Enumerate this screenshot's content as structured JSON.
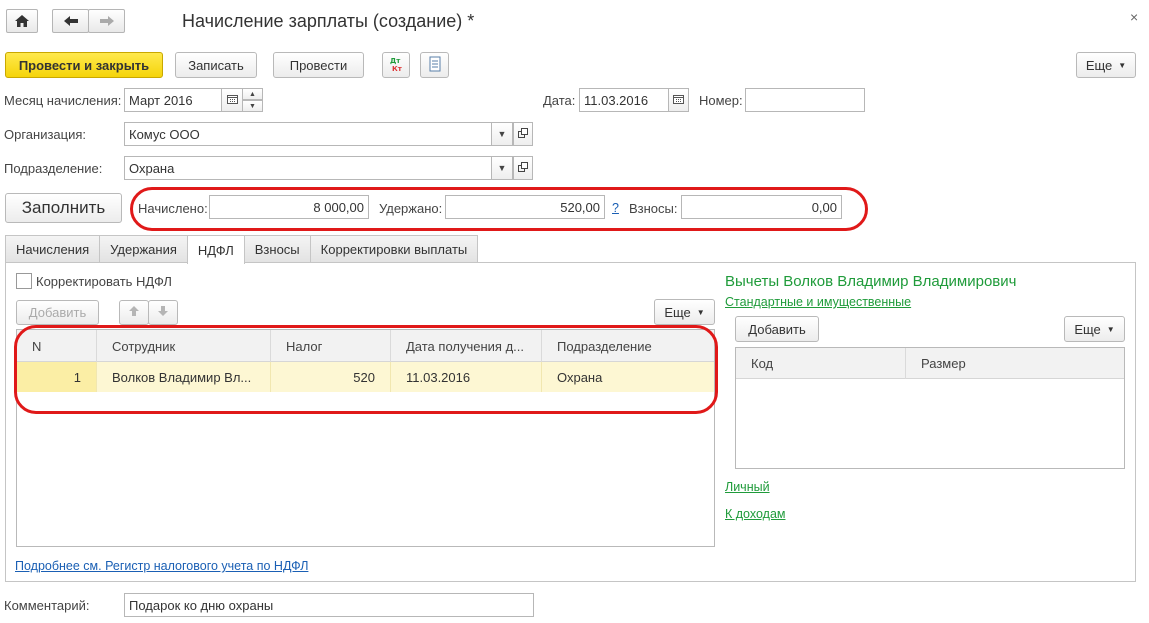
{
  "window": {
    "title": "Начисление зарплаты (создание) *",
    "close_glyph": "×"
  },
  "nav": {
    "home_icon": "home-icon",
    "back_icon": "arrow-left-icon",
    "forward_icon": "arrow-right-icon"
  },
  "toolbar": {
    "post_close": "Провести и закрыть",
    "save": "Записать",
    "post": "Провести",
    "dtkt_icon": "dt-kt-icon",
    "doc_icon": "document-icon",
    "more": "Еще"
  },
  "header": {
    "month_label": "Месяц начисления:",
    "month_value": "Март 2016",
    "date_label": "Дата:",
    "date_value": "11.03.2016",
    "number_label": "Номер:",
    "number_value": "",
    "org_label": "Организация:",
    "org_value": "Комус ООО",
    "dept_label": "Подразделение:",
    "dept_value": "Охрана"
  },
  "totals": {
    "fill_button": "Заполнить",
    "accrued_label": "Начислено:",
    "accrued_value": "8 000,00",
    "withheld_label": "Удержано:",
    "withheld_value": "520,00",
    "help_link": "?",
    "contrib_label": "Взносы:",
    "contrib_value": "0,00"
  },
  "tabs": [
    {
      "label": "Начисления",
      "active": false
    },
    {
      "label": "Удержания",
      "active": false
    },
    {
      "label": "НДФЛ",
      "active": true
    },
    {
      "label": "Взносы",
      "active": false
    },
    {
      "label": "Корректировки выплаты",
      "active": false
    }
  ],
  "ndfl": {
    "correct_checkbox_label": "Корректировать НДФЛ",
    "correct_checked": false,
    "add_button": "Добавить",
    "more_button": "Еще",
    "columns": [
      "N",
      "Сотрудник",
      "Налог",
      "Дата получения д...",
      "Подразделение"
    ],
    "rows": [
      {
        "n": "1",
        "employee": "Волков Владимир Вл...",
        "tax": "520",
        "date": "11.03.2016",
        "dept": "Охрана"
      }
    ],
    "register_link": "Подробнее см. Регистр налогового учета по НДФЛ"
  },
  "deductions": {
    "title": "Вычеты Волков Владимир Владимирович",
    "standard_link": "Стандартные и имущественные",
    "add_button": "Добавить",
    "more_button": "Еще",
    "columns": [
      "Код",
      "Размер"
    ],
    "personal_link": "Личный",
    "income_link": "К доходам"
  },
  "comment": {
    "label": "Комментарий:",
    "value": "Подарок ко дню охраны"
  },
  "colors": {
    "accent_yellow": "#f5d40a",
    "highlight_red": "#e01919",
    "link_green": "#1f9b3a",
    "link_blue": "#1a5fb4",
    "row_selected": "#fdf7d3"
  }
}
